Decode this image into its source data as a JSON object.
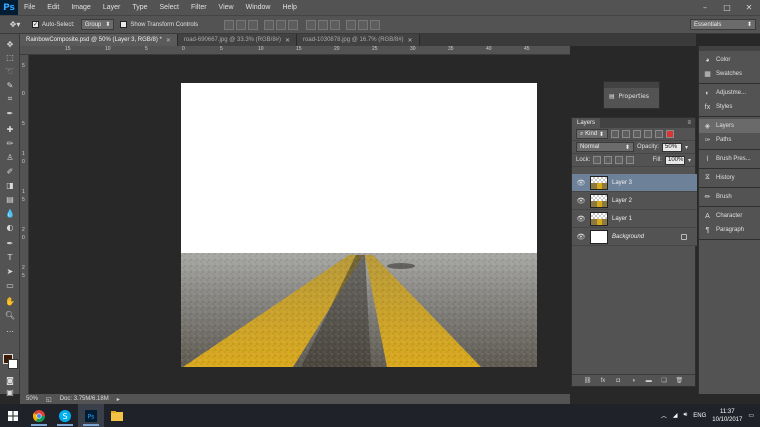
{
  "app": {
    "logo": "Ps"
  },
  "menu": {
    "items": [
      "File",
      "Edit",
      "Image",
      "Layer",
      "Type",
      "Select",
      "Filter",
      "View",
      "Window",
      "Help"
    ]
  },
  "window_controls": {
    "minimize": "–",
    "maximize": "□",
    "close": "✕"
  },
  "options_bar": {
    "tool_icon": "move-tool-icon",
    "auto_select_label": "Auto-Select:",
    "auto_select_checked": true,
    "auto_select_value": "Group",
    "transform_controls_label": "Show Transform Controls",
    "transform_controls_checked": false,
    "workspace": "Essentials"
  },
  "tabs": [
    {
      "label": "RainbowComposite.psd @ 50% (Layer 3, RGB/8) *",
      "active": true
    },
    {
      "label": "road-690667.jpg @ 33.3% (RGB/8#)",
      "active": false
    },
    {
      "label": "road-1030878.jpg @ 16.7% (RGB/8#)",
      "active": false
    }
  ],
  "ruler_top_ticks": [
    "15",
    "10",
    "5",
    "0",
    "5",
    "10",
    "15",
    "20",
    "25",
    "30",
    "35",
    "40",
    "45"
  ],
  "ruler_left_ticks": [
    "5",
    "0",
    "5",
    "1",
    "0",
    "1",
    "5",
    "2",
    "0",
    "2",
    "5"
  ],
  "status": {
    "zoom": "50%",
    "doc": "Doc: 3.75M/6.18M"
  },
  "properties_panel": {
    "label": "Properties"
  },
  "layers_panel": {
    "tab_label": "Layers",
    "filter_kind": "Kind",
    "blend_mode": "Normal",
    "opacity_label": "Opacity:",
    "opacity_value": "50%",
    "lock_label": "Lock:",
    "fill_label": "Fill:",
    "fill_value": "100%",
    "layers": [
      {
        "name": "Layer 3",
        "selected": true,
        "thumb": "road"
      },
      {
        "name": "Layer 2",
        "selected": false,
        "thumb": "road"
      },
      {
        "name": "Layer 1",
        "selected": false,
        "thumb": "road"
      },
      {
        "name": "Background",
        "selected": false,
        "thumb": "white",
        "locked": true
      }
    ],
    "footer_icons": [
      "link-icon",
      "fx-icon",
      "mask-icon",
      "adjustment-icon",
      "folder-icon",
      "new-layer-icon",
      "trash-icon"
    ]
  },
  "dock": {
    "group1": [
      "Color",
      "Swatches"
    ],
    "group2": [
      "Adjustme...",
      "Styles"
    ],
    "group3": [
      "Layers",
      "Paths"
    ],
    "group4": [
      "Brush Pres..."
    ],
    "group5": [
      "History"
    ],
    "group6": [
      "Brush"
    ],
    "group7": [
      "Character",
      "Paragraph"
    ]
  },
  "taskbar": {
    "language": "ENG",
    "time": "11:37",
    "date": "10/10/2017",
    "apps": [
      "start-icon",
      "chrome-icon",
      "skype-icon",
      "photoshop-icon",
      "file-explorer-icon"
    ]
  },
  "colors": {
    "ui_panel": "#535353",
    "canvas_bg": "#282828",
    "selected_layer": "#6d8299",
    "road_yellow": "#d6a81a",
    "asphalt": "#7b7b78"
  }
}
